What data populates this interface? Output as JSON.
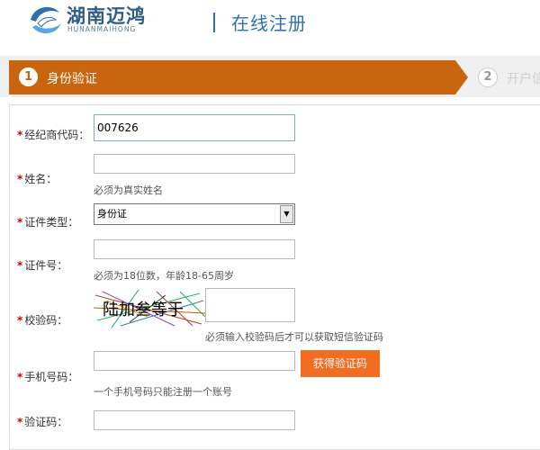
{
  "header": {
    "logo_cn": "湖南迈鸿",
    "logo_en": "HUNANMAIHONG",
    "title": "在线注册"
  },
  "steps": [
    {
      "number": "1",
      "label": "身份验证",
      "active": true
    },
    {
      "number": "2",
      "label": "开户信",
      "active": false
    }
  ],
  "form": {
    "required_mark": "*",
    "dealer_code": {
      "label": "经纪商代码：",
      "value": "007626"
    },
    "name": {
      "label": "姓名：",
      "value": "",
      "hint": "必须为真实姓名"
    },
    "id_type": {
      "label": "证件类型：",
      "selected": "身份证"
    },
    "id_number": {
      "label": "证件号：",
      "value": "",
      "hint": "必须为18位数，年龄18-65周岁"
    },
    "captcha": {
      "label": "校验码：",
      "image_text": "陆加叁等于",
      "value": "",
      "hint": "必须输入校验码后才可以获取短信验证码"
    },
    "phone": {
      "label": "手机号码：",
      "value": "",
      "hint": "一个手机号码只能注册一个账号",
      "sms_button": "获得验证码"
    },
    "sms_code": {
      "label": "验证码：",
      "value": ""
    }
  },
  "colors": {
    "brand_blue": "#2f6fae",
    "step_active": "#c9640f",
    "sms_button": "#f26d21",
    "required": "#d00000"
  }
}
